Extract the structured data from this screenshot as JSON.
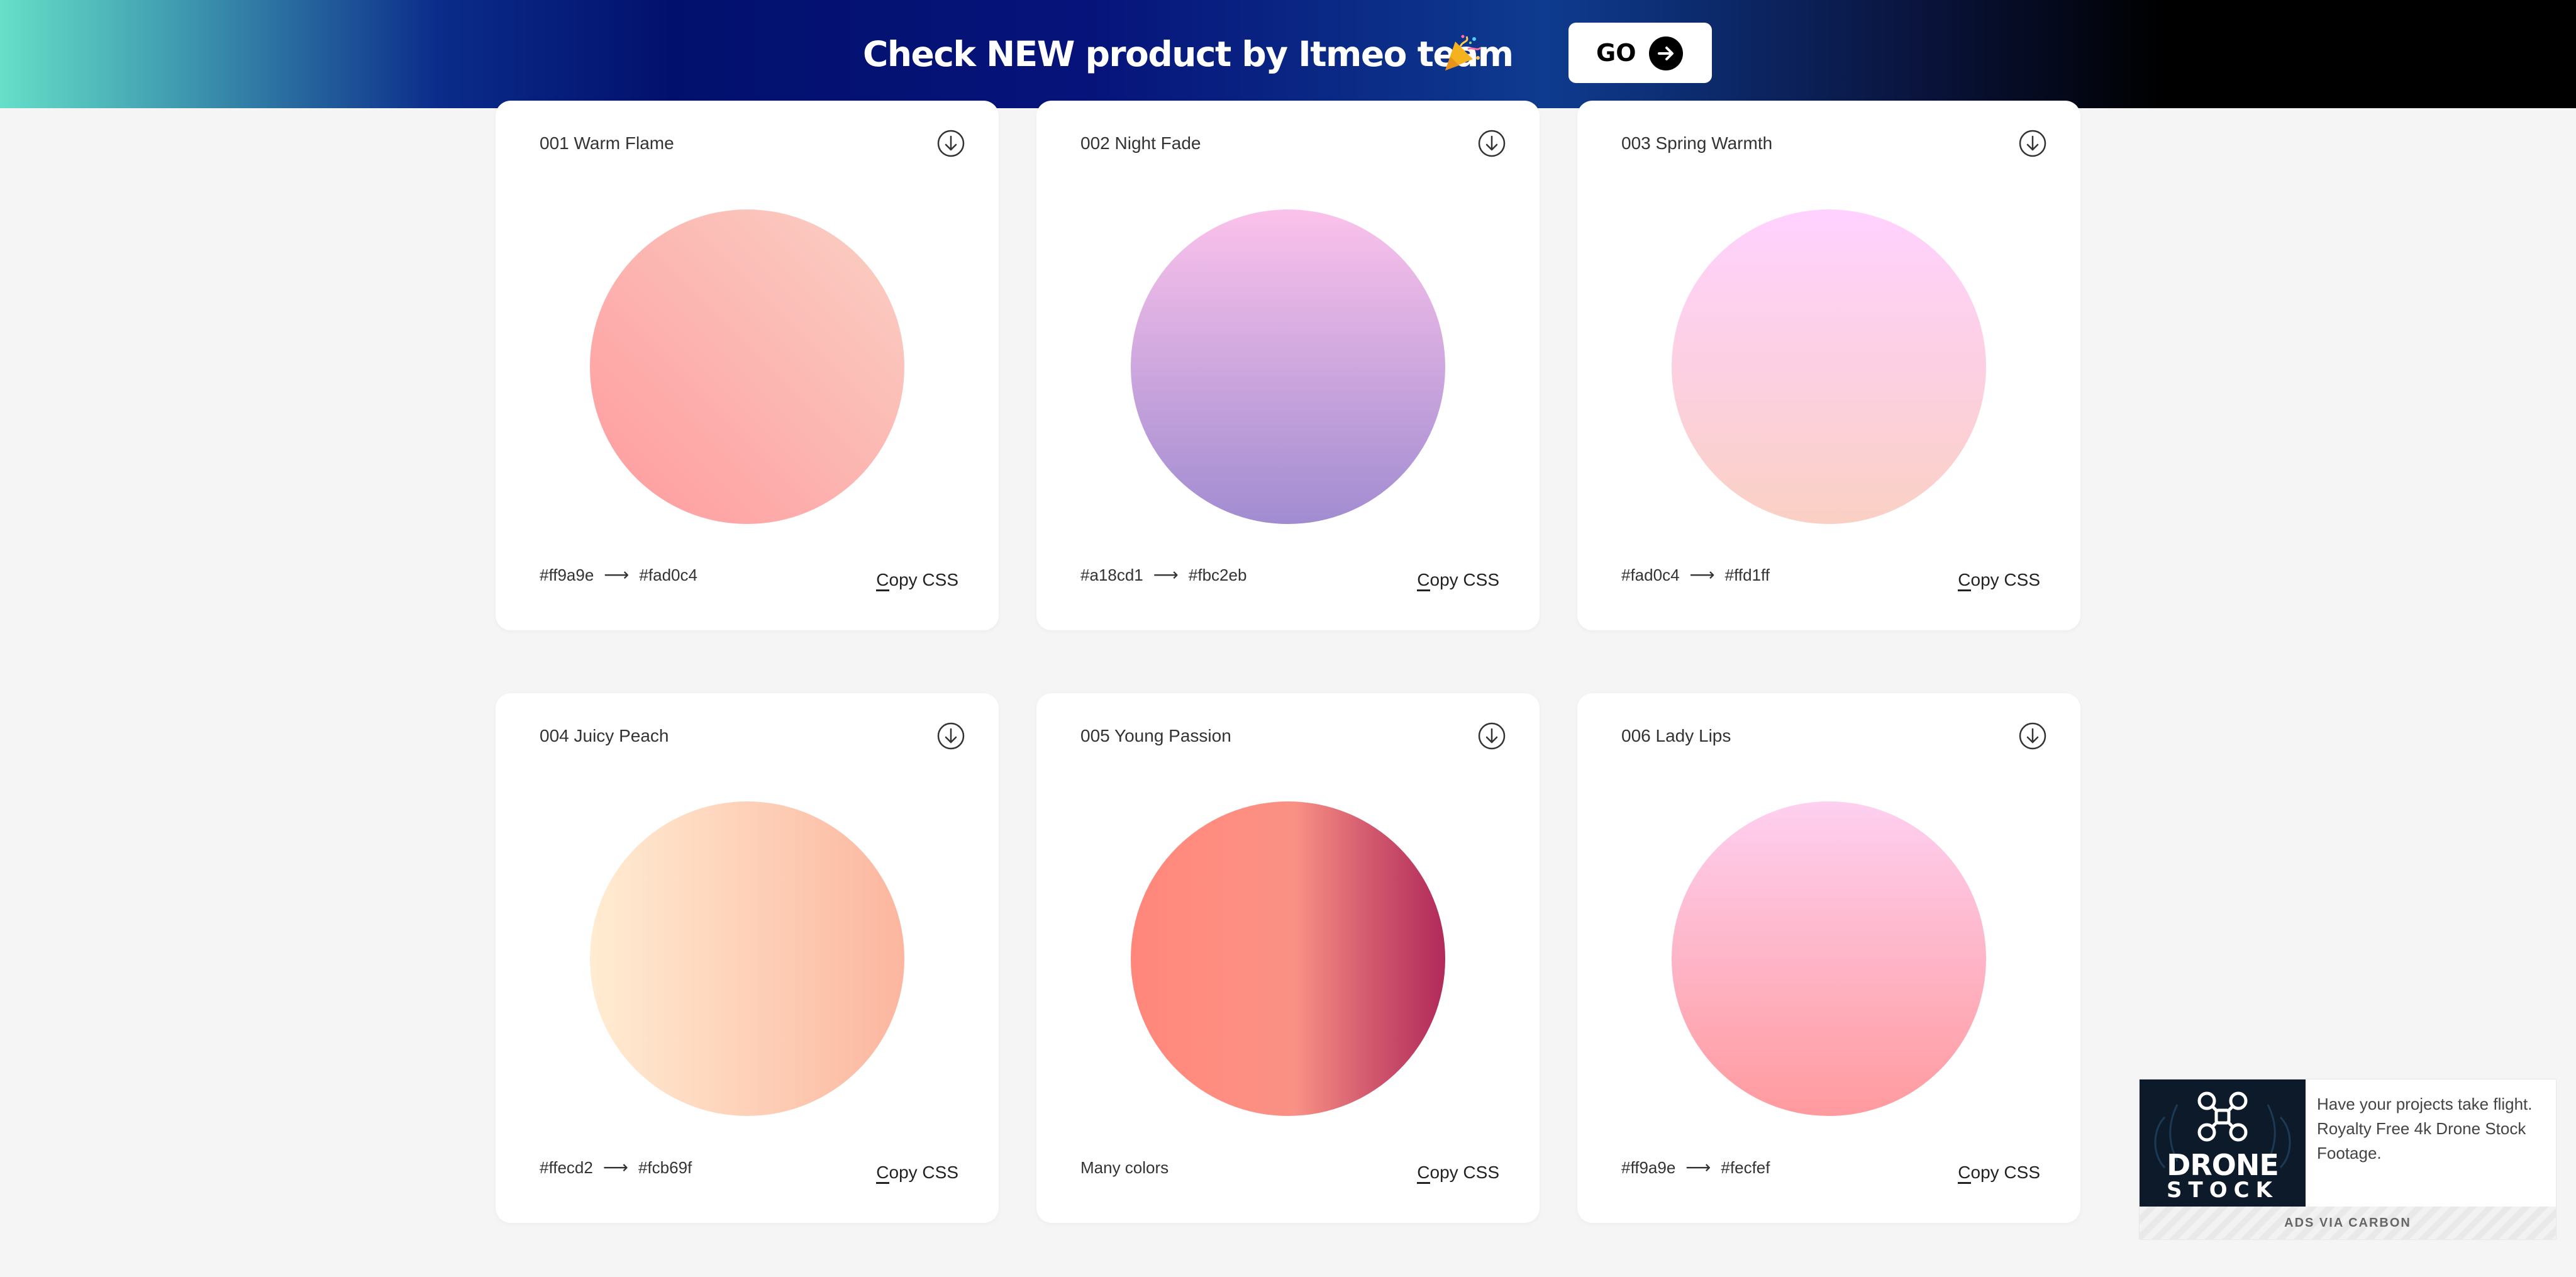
{
  "banner": {
    "text": "Check NEW product by Itmeo team",
    "icon": "party-popper-icon",
    "go_label": "GO",
    "go_icon": "arrow-right-circle-icon"
  },
  "copy_label": "Copy CSS",
  "arrow_glyph": "⟶",
  "cards": [
    {
      "title": "001 Warm Flame",
      "color_from": "#ff9a9e",
      "color_to": "#fad0c4",
      "colors_text": "",
      "gradient": "linear-gradient(45deg, #ff9a9e 0%, #fad0c4 99%, #fad0c4 100%)"
    },
    {
      "title": "002 Night Fade",
      "color_from": "#a18cd1",
      "color_to": "#fbc2eb",
      "colors_text": "",
      "gradient": "linear-gradient(to top, #a18cd1 0%, #fbc2eb 100%)"
    },
    {
      "title": "003 Spring Warmth",
      "color_from": "#fad0c4",
      "color_to": "#ffd1ff",
      "colors_text": "",
      "gradient": "linear-gradient(to top, #fad0c4 0%, #ffd1ff 100%)"
    },
    {
      "title": "004 Juicy Peach",
      "color_from": "#ffecd2",
      "color_to": "#fcb69f",
      "colors_text": "",
      "gradient": "linear-gradient(to right, #ffecd2 0%, #fcb69f 100%)"
    },
    {
      "title": "005 Young Passion",
      "color_from": "",
      "color_to": "",
      "colors_text": "Many colors",
      "gradient": "linear-gradient(to right, #ff8177 0%, #ff867a 0%, #ff8c7f 21%, #f99185 52%, #cf556c 78%, #b12a5b 100%)"
    },
    {
      "title": "006 Lady Lips",
      "color_from": "#ff9a9e",
      "color_to": "#fecfef",
      "colors_text": "",
      "gradient": "linear-gradient(to top, #ff9a9e 0%, #fecfef 99%, #fecfef 100%)"
    }
  ],
  "ad": {
    "brand_line1": "DRONE",
    "brand_line2": "STOCK",
    "logo_icon": "drone-icon",
    "text": "Have your projects take flight. Royalty Free 4k Drone Stock Footage.",
    "footer": "ADS VIA CARBON"
  },
  "colors": {
    "page_bg": "#f5f5f5",
    "card_bg": "#ffffff",
    "text": "#333333"
  }
}
